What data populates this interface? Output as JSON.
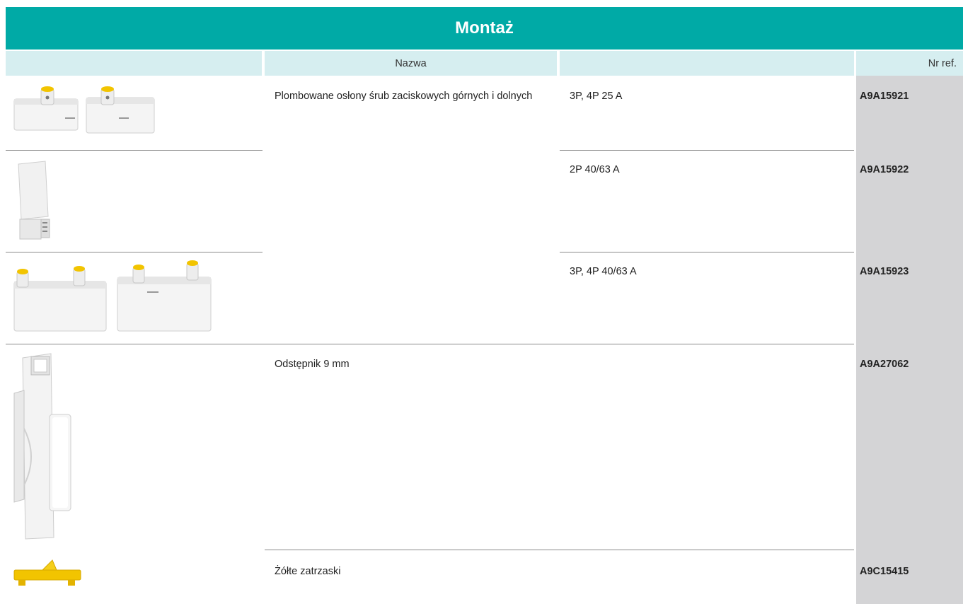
{
  "title": "Montaż",
  "header": {
    "col_image": "",
    "col_name": "Nazwa",
    "col_desc": "",
    "col_ref": "Nr ref."
  },
  "rows": [
    {
      "image_icon": "terminal-cover-pair-icon",
      "name": "Plombowane osłony śrub zaciskowych górnych i dolnych",
      "desc": "3P, 4P 25 A",
      "ref": "A9A15921"
    },
    {
      "image_icon": "terminal-cover-side-icon",
      "name": "",
      "desc": "2P 40/63 A",
      "ref": "A9A15922"
    },
    {
      "image_icon": "terminal-cover-wide-pair-icon",
      "name": "",
      "desc": "3P, 4P 40/63 A",
      "ref": "A9A15923"
    },
    {
      "image_icon": "spacer-9mm-icon",
      "name": "Odstępnik 9 mm",
      "desc": "",
      "ref": "A9A27062"
    },
    {
      "image_icon": "yellow-clip-icon",
      "name": "Żółte zatrzaski",
      "desc": "",
      "ref": "A9C15415"
    }
  ],
  "colors": {
    "title_bg": "#00aaa6",
    "header_bg": "#d6eef0",
    "ref_column_bg": "#d4d4d6",
    "clip_yellow": "#f2c400"
  }
}
